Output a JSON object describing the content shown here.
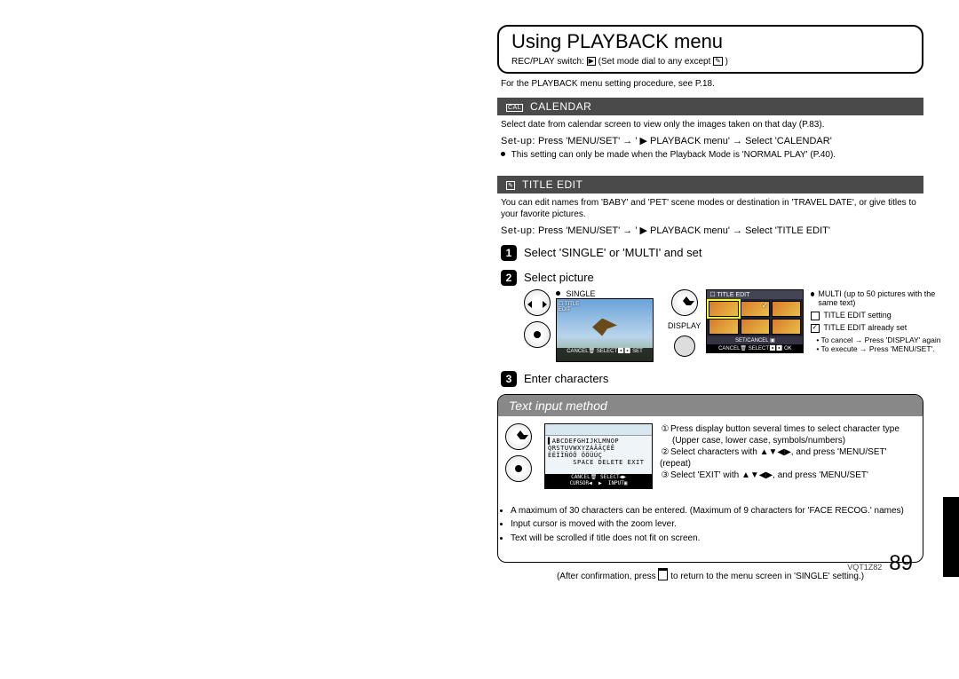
{
  "header": {
    "title": "Using PLAYBACK menu",
    "sub_prefix": "REC/PLAY switch: ",
    "sub_suffix": " (Set mode dial to any except ",
    "sub_end": ")"
  },
  "proc_ref": "For the PLAYBACK menu setting procedure, see P.18.",
  "calendar": {
    "bar_icon": "CAL",
    "bar": "CALENDAR",
    "text": "Select date from calendar screen to view only the images taken on that day (P.83).",
    "setup_label": "Set-up:",
    "setup_text": "Press 'MENU/SET' → ' ▶ PLAYBACK menu' → Select 'CALENDAR'",
    "note": "This setting can only be made when the Playback Mode is 'NORMAL PLAY' (P.40)."
  },
  "titleedit": {
    "bar": "TITLE EDIT",
    "text": "You can edit names from 'BABY' and 'PET' scene modes or destination in 'TRAVEL DATE', or give titles to your favorite pictures.",
    "setup_label": "Set-up:",
    "setup_text": "Press 'MENU/SET' → ' ▶ PLAYBACK menu' → Select 'TITLE EDIT'",
    "steps": {
      "s1": "Select 'SINGLE' or 'MULTI' and set",
      "s2": "Select picture",
      "s3": "Enter characters"
    },
    "single_label": "SINGLE",
    "single_screen_top": "☐ TITLE\nEDIT",
    "single_screen_bar": "CANCEL🗑 SELECT◀▶ SET",
    "multi_heading": "MULTI (up to 50 pictures with the same text)",
    "multi_leg1": "TITLE EDIT setting",
    "multi_leg2": "TITLE EDIT already set",
    "multi_note1": "To cancel → Press 'DISPLAY' again",
    "multi_note2": "To execute → Press 'MENU/SET'.",
    "multi_title": "☐ TITLE EDIT",
    "multi_bar": "CANCEL🗑 SELECT◀▶  OK",
    "multi_setcancel": "SET/CANCEL ▣",
    "display_label": "DISPLAY"
  },
  "textinput": {
    "header": "Text input method",
    "screen_lines": "ABCDEFGHIJKLMNOP\nQRSTUVWXYZÁÂÃÇÉÊ\nËËÏÏÑÓÔ ÖÖÜÚÇ\n      SPACE DELETE EXIT",
    "screen_bot": "CANCEL🗑 SELECT◀▶\nCURSOR◀  ▶  INPUT▣",
    "r1": "Press display button several times to select character type",
    "r1b": "(Upper case, lower case, symbols/numbers)",
    "r2a": "Select characters with ",
    "r2b": ", and press 'MENU/SET' (repeat)",
    "r3a": "Select 'EXIT' with ",
    "r3b": ", and press 'MENU/SET'",
    "arrows": "▲▼◀▶",
    "notes": [
      "A maximum of 30 characters can be entered. (Maximum of 9 characters for 'FACE RECOG.' names)",
      "Input cursor is moved with the zoom lever.",
      "Text will be scrolled if title does not fit on screen."
    ]
  },
  "after": {
    "prefix": "(After confirmation, press ",
    "suffix": " to return to the menu screen in 'SINGLE' setting.)"
  },
  "footer": {
    "code": "VQT1Z82",
    "page": "89"
  }
}
